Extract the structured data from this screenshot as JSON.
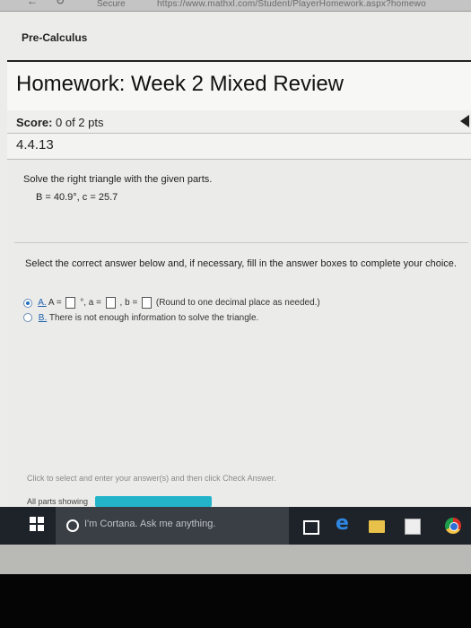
{
  "browser": {
    "secure_label": "Secure",
    "url": "https://www.mathxl.com/Student/PlayerHomework.aspx?homewo"
  },
  "course": "Pre-Calculus",
  "homework_title": "Homework: Week 2 Mixed Review",
  "score": {
    "label": "Score:",
    "value": "0 of 2 pts"
  },
  "question_number": "4.4.13",
  "question": {
    "prompt": "Solve the right triangle with the given parts.",
    "givens": "B = 40.9°, c = 25.7",
    "instruction": "Select the correct answer below and, if necessary, fill in the answer boxes to complete your choice.",
    "options": [
      {
        "label": "A.",
        "selected": true,
        "parts": [
          "A =",
          "°, a =",
          ", b =",
          "(Round to one decimal place as needed.)"
        ]
      },
      {
        "label": "B.",
        "selected": false,
        "text": "There is not enough information to solve the triangle."
      }
    ]
  },
  "footer": {
    "hint": "Click to select and enter your answer(s) and then click Check Answer.",
    "parts_label": "All parts showing",
    "progress": 1.0
  },
  "taskbar": {
    "search_placeholder": "I'm Cortana. Ask me anything.",
    "icons": [
      "windows-icon",
      "cortana-icon",
      "task-view-icon",
      "edge-icon",
      "file-explorer-icon",
      "store-icon",
      "chrome-icon"
    ]
  }
}
